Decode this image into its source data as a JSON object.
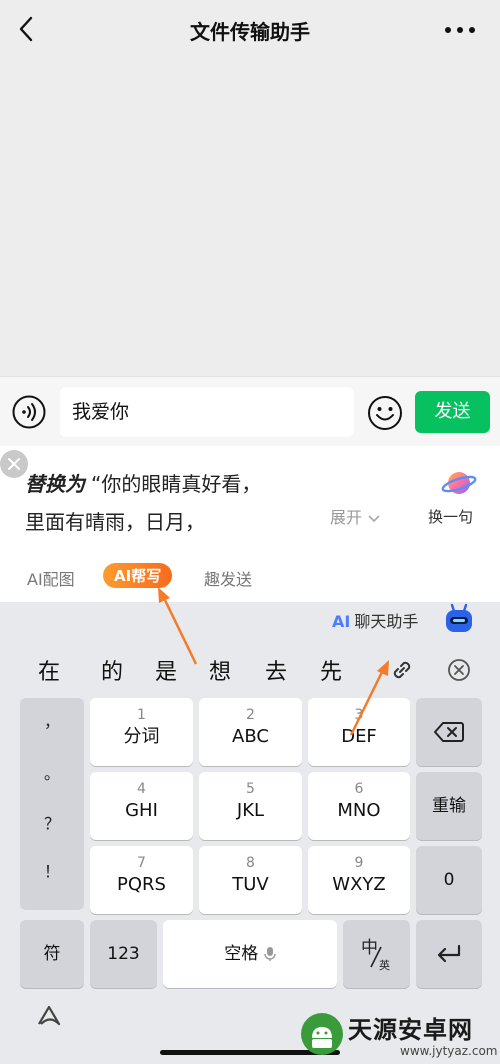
{
  "header": {
    "title": "文件传输助手",
    "back_icon": "chevron-left-icon",
    "more_icon": "more-horizontal-icon"
  },
  "input_bar": {
    "voice_icon": "voice-icon",
    "message_value": "我爱你",
    "emoji_icon": "emoji-icon",
    "send_label": "发送",
    "send_color": "#07c160"
  },
  "ai_panel": {
    "replace_label": "替换为",
    "suggestion_line1": "“你的眼睛真好看，",
    "suggestion_line2": "里面有晴雨，日月，",
    "expand_label": "展开",
    "swap_label": "换一句",
    "tabs": [
      {
        "label": "AI配图"
      },
      {
        "label": "AI帮写"
      },
      {
        "label": "趣发送"
      }
    ],
    "active_tab_color": "#f7841f"
  },
  "keyboard": {
    "ai_mark": "AI",
    "assistant_label": "聊天助手",
    "candidates": [
      "在",
      "的",
      "是",
      "想",
      "去",
      "先"
    ],
    "punctuation": [
      "，",
      "。",
      "？",
      "！"
    ],
    "keys": [
      {
        "num": "1",
        "letters": "分词"
      },
      {
        "num": "2",
        "letters": "ABC"
      },
      {
        "num": "3",
        "letters": "DEF"
      },
      {
        "num": "4",
        "letters": "GHI"
      },
      {
        "num": "5",
        "letters": "JKL"
      },
      {
        "num": "6",
        "letters": "MNO"
      },
      {
        "num": "7",
        "letters": "PQRS"
      },
      {
        "num": "8",
        "letters": "TUV"
      },
      {
        "num": "9",
        "letters": "WXYZ"
      }
    ],
    "reinput_label": "重输",
    "zero_label": "0",
    "symbol_label": "符",
    "num123_label": "123",
    "space_label": "空格",
    "lang_zh": "中",
    "lang_en": "英"
  },
  "watermark": {
    "text": "天源安卓网",
    "url": "www.jytyaz.com"
  }
}
